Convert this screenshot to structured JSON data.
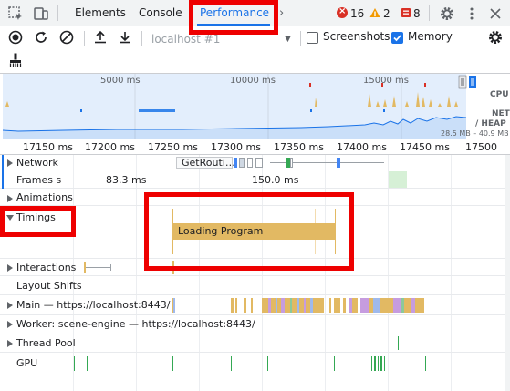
{
  "tabs": {
    "elements": "Elements",
    "console": "Console",
    "performance": "Performance"
  },
  "badges": {
    "errors": "16",
    "warnings": "2",
    "issues": "8"
  },
  "toolbar": {
    "url": "localhost #1",
    "screenshots_label": "Screenshots",
    "memory_label": "Memory"
  },
  "overview": {
    "labels": [
      "5000 ms",
      "10000 ms",
      "15000 ms"
    ],
    "cpu_label": "CPU",
    "net_label": "NET",
    "heap_label": "HEAP",
    "heap_range": "28.5 MB – 40.9 MB"
  },
  "ruler": {
    "ticks": [
      "17150 ms",
      "17200 ms",
      "17250 ms",
      "17300 ms",
      "17350 ms",
      "17400 ms",
      "17450 ms",
      "17500"
    ]
  },
  "tracks": {
    "network": "Network",
    "network_event": "GetRouti…",
    "frames": "Frames",
    "frames_suffix": "s",
    "frame1": "83.3 ms",
    "frame2": "150.0 ms",
    "animations": "Animations",
    "timings": "Timings",
    "timing_event": "Loading Program",
    "interactions": "Interactions",
    "layout_shifts": "Layout Shifts",
    "main": "Main — https://localhost:8443/",
    "worker": "Worker: scene-engine — https://localhost:8443/",
    "thread_pool": "Thread Pool",
    "gpu": "GPU"
  },
  "colors": {
    "accent": "#1a73e8",
    "timing_bar": "#e2b963",
    "highlight": "#ee0000"
  }
}
